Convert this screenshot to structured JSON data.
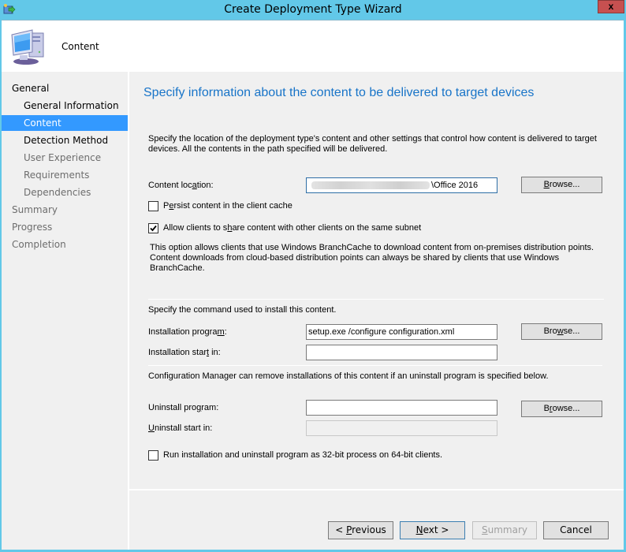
{
  "window": {
    "title": "Create Deployment Type Wizard",
    "close_label": "x"
  },
  "header": {
    "title": "Content",
    "icon": "computer-icon"
  },
  "sidebar": {
    "items": [
      {
        "label": "General",
        "state": "enabled",
        "level": 0
      },
      {
        "label": "General Information",
        "state": "enabled",
        "level": 1
      },
      {
        "label": "Content",
        "state": "active",
        "level": 1
      },
      {
        "label": "Detection Method",
        "state": "enabled",
        "level": 1
      },
      {
        "label": "User Experience",
        "state": "disabled",
        "level": 1
      },
      {
        "label": "Requirements",
        "state": "disabled",
        "level": 1
      },
      {
        "label": "Dependencies",
        "state": "disabled",
        "level": 1
      },
      {
        "label": "Summary",
        "state": "disabled",
        "level": 0
      },
      {
        "label": "Progress",
        "state": "disabled",
        "level": 0
      },
      {
        "label": "Completion",
        "state": "disabled",
        "level": 0
      }
    ]
  },
  "main": {
    "heading": "Specify information about the content to be delivered to target devices",
    "description_line1": "Specify the location of the deployment type's content and other settings that control how content is delivered to target",
    "description_line2": "devices. All the contents in the path specified will be delivered.",
    "content_location": {
      "label_pre": "Content loc",
      "label_u": "a",
      "label_post": "tion:",
      "value_visible": "\\Office 2016",
      "browse_pre": "",
      "browse_u": "B",
      "browse_post": "rowse..."
    },
    "persist_cache": {
      "label_pre": "P",
      "label_u": "e",
      "label_post": "rsist content in the client cache",
      "checked": false
    },
    "share_content": {
      "label_pre": "Allow clients to s",
      "label_u": "h",
      "label_post": "are content with other clients on the same subnet",
      "checked": true
    },
    "branchcache_note_line1": "This option allows clients that use Windows BranchCache to download content from on-premises distribution points.",
    "branchcache_note_line2": "Content downloads from cloud-based distribution points can always be shared by clients that use Windows",
    "branchcache_note_line3": "BranchCache.",
    "install_section_label": "Specify the command used to install this content.",
    "installation_program": {
      "label_pre": "Installation progra",
      "label_u": "m",
      "label_post": ":",
      "value": "setup.exe /configure configuration.xml",
      "browse_pre": "Bro",
      "browse_u": "w",
      "browse_post": "se..."
    },
    "installation_start_in": {
      "label_pre": "Installation star",
      "label_u": "t",
      "label_post": " in:",
      "value": ""
    },
    "uninstall_section_label": "Configuration Manager can remove installations of this content if an uninstall program is specified below.",
    "uninstall_program": {
      "label_pre": "Uninstall pro",
      "label_u": "g",
      "label_post": "ram:",
      "value": "",
      "browse_pre": "B",
      "browse_u": "r",
      "browse_post": "owse..."
    },
    "uninstall_start_in": {
      "label_pre": "",
      "label_u": "U",
      "label_post": "ninstall start in:",
      "value": ""
    },
    "run_32bit": {
      "label_pre": "Run installation and uninstall pro",
      "label_u": "g",
      "label_post": "ram as 32-bit process on 64-bit clients.",
      "checked": false
    }
  },
  "footer": {
    "previous": {
      "pre": "< ",
      "u": "P",
      "post": "revious"
    },
    "next": {
      "pre": "",
      "u": "N",
      "post": "ext >"
    },
    "summary": {
      "pre": "",
      "u": "S",
      "post": "ummary"
    },
    "cancel": {
      "pre": "",
      "u": "",
      "post": "Cancel"
    }
  }
}
